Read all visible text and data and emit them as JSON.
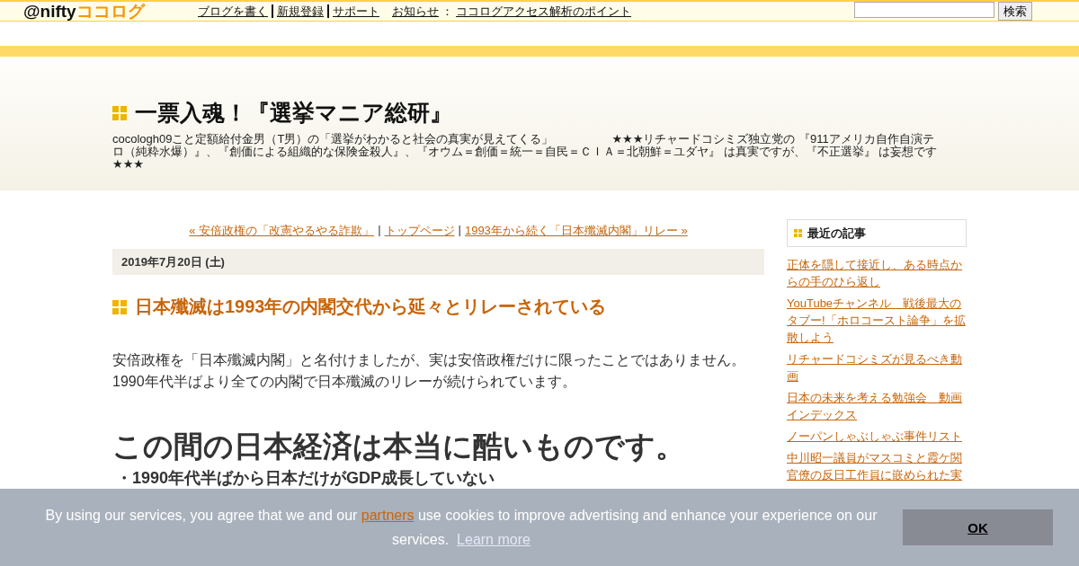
{
  "topbar": {
    "logo": {
      "brand": "@nifty",
      "product": "ココログ"
    },
    "links": [
      {
        "label": "ブログを書く"
      },
      {
        "label": "新規登録"
      },
      {
        "label": "サポート"
      }
    ],
    "notice": {
      "label": "お知らせ",
      "separator": "：",
      "link": "ココログアクセス解析のポイント"
    },
    "search": {
      "button": "検索"
    }
  },
  "blog": {
    "title": "一票入魂！『選挙マニア総研』",
    "description": "cocologh09こと定額給付金男（T男）の「選挙がわかると社会の真実が見えてくる」　　　　　★★★リチャードコシミズ独立党の 『911アメリカ自作自演テロ（純粋水爆）』、『創価による組織的な保険金殺人』、『オウム＝創価＝統一＝自民＝ＣＩＡ＝北朝鮮＝ユダヤ』 は真実ですが、『不正選挙』 は妄想です★★★"
  },
  "nav": {
    "prev": "« 安倍政権の「改憲やるやる詐欺」",
    "separator": "|",
    "top": "トップページ",
    "next": "1993年から続く「日本殲滅内閣」リレー »"
  },
  "post": {
    "date": "2019年7月20日 (土)",
    "title": "日本殲滅は1993年の内閣交代から延々とリレーされている",
    "body": [
      "安倍政権を「日本殲滅内閣」と名付けましたが、実は安倍政権だけに限ったことではありません。",
      "1990年代半ばより全ての内閣で日本殲滅のリレーが続けられています。"
    ],
    "heading": "この間の日本経済は本当に酷いものです。",
    "subheading": "・1990年代半ばから日本だけがGDP成長していない"
  },
  "sidebar": {
    "title": "最近の記事",
    "items": [
      {
        "label": "正体を隠して接近し、ある時点からの手のひら返し"
      },
      {
        "label": "YouTubeチャンネル　戦後最大のタブー!「ホロコースト論争」を拡散しよう"
      },
      {
        "label": "リチャードコシミズが見るべき動画"
      },
      {
        "label": "日本の未来を考える勉強会　動画インデックス"
      },
      {
        "label": "ノーパンしゃぶしゃぶ事件リスト"
      },
      {
        "label": "中川昭一議員がマスコミと霞ケ関官僚の反日工作員に嵌められた実"
      }
    ]
  },
  "cookie_banner": {
    "text_before": "By using our services, you agree that we and our",
    "partners": "partners",
    "text_after": "use cookies to improve advertising and enhance your experience on our services.",
    "learn_more": "Learn more",
    "button": "OK"
  }
}
